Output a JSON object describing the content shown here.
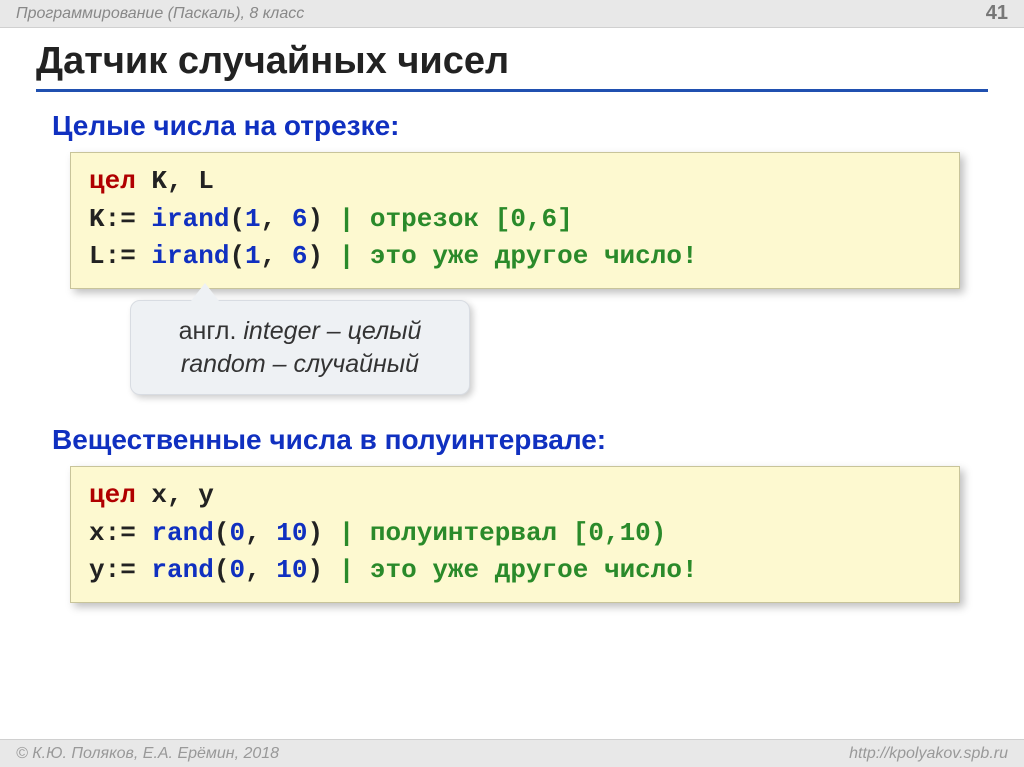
{
  "header": {
    "subject": "Программирование (Паскаль), 8 класс",
    "page": "41"
  },
  "title": "Датчик случайных чисел",
  "section1": "Целые числа на отрезке:",
  "code1": {
    "kw": "цел",
    "vars": " K, L",
    "l2a": "K:= ",
    "l2fn": "irand",
    "l2p": "(",
    "l2n1": "1",
    "l2c": ", ",
    "l2n2": "6",
    "l2q": ") ",
    "l2cm": "| отрезок [0,6]",
    "l3a": "L:= ",
    "l3fn": "irand",
    "l3p": "(",
    "l3n1": "1",
    "l3c": ", ",
    "l3n2": "6",
    "l3q": ") ",
    "l3cm": "| это уже другое число!"
  },
  "note": {
    "l1a": "англ. ",
    "l1b": "integer ",
    "l1c": "– целый",
    "l2a": "random ",
    "l2b": "– случайный"
  },
  "section2": "Вещественные числа в полуинтервале:",
  "code2": {
    "kw": "цел",
    "vars": " x, y",
    "l2a": "x:= ",
    "l2fn": "rand",
    "l2p": "(",
    "l2n1": "0",
    "l2c": ", ",
    "l2n2": "10",
    "l2q": ") ",
    "l2cm": "| полуинтервал [0,10)",
    "l3a": "y:= ",
    "l3fn": "rand",
    "l3p": "(",
    "l3n1": "0",
    "l3c": ", ",
    "l3n2": "10",
    "l3q": ") ",
    "l3cm": "| это уже другое число!"
  },
  "footer": {
    "left": "© К.Ю. Поляков, Е.А. Ерёмин, 2018",
    "right": "http://kpolyakov.spb.ru"
  }
}
